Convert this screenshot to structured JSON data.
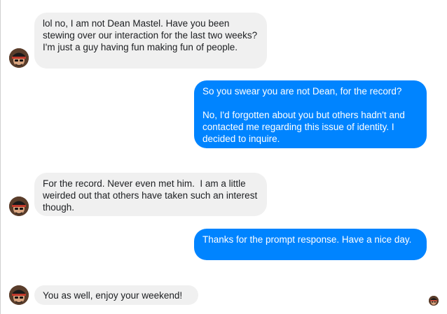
{
  "conversation": {
    "messages": [
      {
        "side": "incoming",
        "text": "lol no, I am not Dean Mastel. Have you been stewing over our interaction for the last two weeks?  I'm just a guy having fun making fun of people."
      },
      {
        "side": "outgoing",
        "text": "So you swear you are not Dean, for the record?\n\nNo, I'd forgotten about you but others hadn't and contacted me regarding this issue of identity. I decided to inquire."
      },
      {
        "side": "incoming",
        "text": "For the record. Never even met him.  I am a little weirded out that others have taken such an interest though."
      },
      {
        "side": "outgoing",
        "text": "Thanks for the prompt response. Have a nice day."
      },
      {
        "side": "incoming",
        "text": "You as well, enjoy your weekend!"
      }
    ],
    "avatar_icon": "user-avatar-icon",
    "read_receipt_icon": "read-receipt-avatar-icon"
  },
  "colors": {
    "incoming_bubble": "#f0f0f0",
    "outgoing_bubble": "#0084ff",
    "incoming_text": "#1c1e21",
    "outgoing_text": "#ffffff"
  }
}
